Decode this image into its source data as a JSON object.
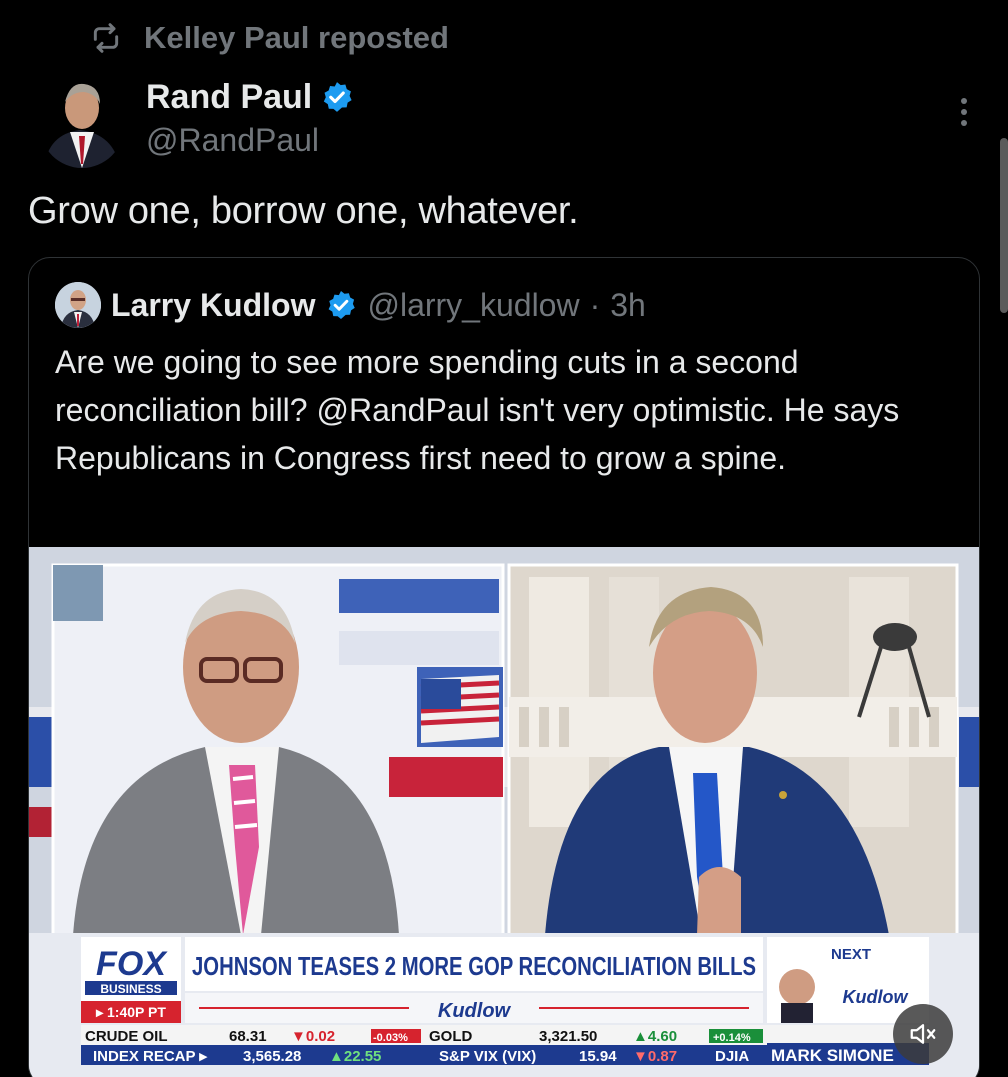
{
  "repost": {
    "label": "Kelley Paul reposted"
  },
  "author": {
    "name": "Rand Paul",
    "handle": "@RandPaul"
  },
  "post": {
    "text": "Grow one, borrow one, whatever."
  },
  "quote": {
    "name": "Larry Kudlow",
    "handle": "@larry_kudlow",
    "separator": "·",
    "time": "3h",
    "text": "Are we going to see more spending cuts in a second reconciliation bill? @RandPaul isn't very optimistic. He says Republicans in Congress first need to grow a spine."
  },
  "video": {
    "network": "FOX",
    "network_sub": "BUSINESS",
    "time": "▸ 1:40P PT",
    "headline": "JOHNSON TEASES 2 MORE GOP RECONCILIATION BILLS",
    "show": "Kudlow",
    "next_label": "NEXT",
    "next_show": "Kudlow",
    "next_host": "MARK SIMONE",
    "ticker_row1": [
      "CRUDE OIL",
      "68.31",
      "▼0.02",
      "-0.03%",
      "GOLD",
      "3,321.50",
      "▲4.60",
      "+0.14%"
    ],
    "ticker_row2": [
      "INDEX RECAP ▸",
      "3,565.28",
      "▲22.55",
      "S&P VIX (VIX)",
      "15.94",
      "▼0.87",
      "DJIA"
    ]
  },
  "icons": {
    "repost": "repost-icon",
    "verified": "verified-badge-icon",
    "more": "more-options-icon",
    "mute": "muted-speaker-icon"
  },
  "colors": {
    "background": "#000000",
    "text_primary": "#e7e9ea",
    "text_secondary": "#71767b",
    "verified_blue": "#1d9bf0",
    "fox_blue": "#1d3a8f",
    "fox_red": "#d6232e"
  }
}
